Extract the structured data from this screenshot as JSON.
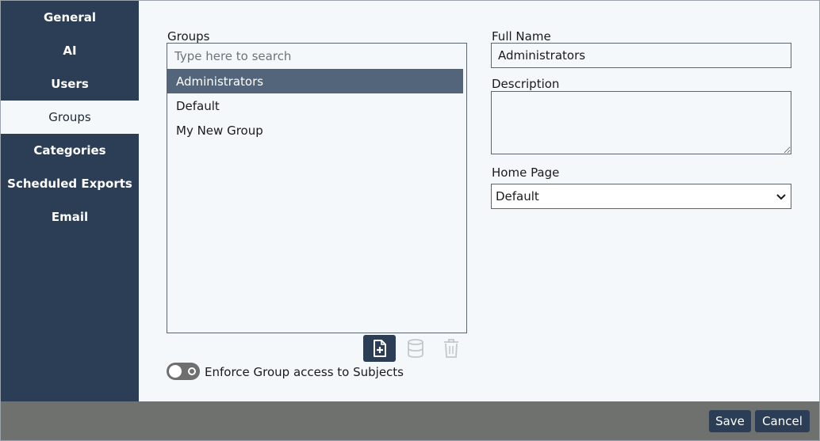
{
  "sidebar": {
    "items": [
      {
        "label": "General"
      },
      {
        "label": "AI"
      },
      {
        "label": "Users"
      },
      {
        "label": "Groups",
        "active": true
      },
      {
        "label": "Categories"
      },
      {
        "label": "Scheduled Exports"
      },
      {
        "label": "Email"
      }
    ]
  },
  "groups": {
    "label": "Groups",
    "search_placeholder": "Type here to search",
    "items": [
      {
        "name": "Administrators",
        "selected": true
      },
      {
        "name": "Default"
      },
      {
        "name": "My New Group"
      }
    ],
    "actions": [
      {
        "icon": "add-file-icon",
        "enabled": true
      },
      {
        "icon": "database-icon",
        "enabled": false
      },
      {
        "icon": "trash-icon",
        "enabled": false
      }
    ]
  },
  "toggle": {
    "label": "Enforce Group access to Subjects",
    "checked": false
  },
  "form": {
    "full_name_label": "Full Name",
    "full_name_value": "Administrators",
    "description_label": "Description",
    "description_value": "",
    "home_page_label": "Home Page",
    "home_page_value": "Default"
  },
  "footer": {
    "save_label": "Save",
    "cancel_label": "Cancel"
  },
  "colors": {
    "sidebar": "#2b3e55",
    "selected_row": "#52657b",
    "footer": "#6f716f",
    "background": "#f4f8fb"
  }
}
